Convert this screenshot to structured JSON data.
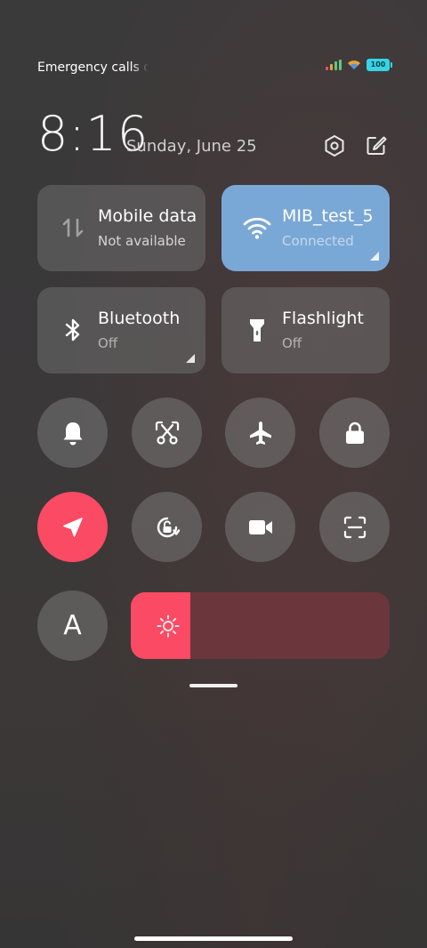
{
  "status_bar": {
    "carrier_text": "Emergency calls o",
    "battery_level": "100",
    "colors": {
      "signal": [
        "#e0556b",
        "#e8a43c",
        "#62c77a",
        "#62c77a"
      ],
      "battery": "#35d4e6"
    }
  },
  "header": {
    "time": "8:16",
    "date": "Sunday, June 25",
    "settings_icon": "settings-hexagon-icon",
    "edit_icon": "edit-pencil-icon"
  },
  "tiles": {
    "mobile_data": {
      "title": "Mobile data",
      "subtitle": "Not available",
      "icon": "mobile-data-arrows-icon"
    },
    "wifi": {
      "title": "MIB_test_5",
      "subtitle": "Connected",
      "icon": "wifi-icon",
      "color": "#7aa8d6"
    },
    "bluetooth": {
      "title": "Bluetooth",
      "subtitle": "Off",
      "icon": "bluetooth-icon"
    },
    "flashlight": {
      "title": "Flashlight",
      "subtitle": "Off",
      "icon": "flashlight-icon"
    }
  },
  "toggles": {
    "row1": [
      {
        "name": "bell-icon",
        "state": "off"
      },
      {
        "name": "screenshot-scissors-icon",
        "state": "off"
      },
      {
        "name": "airplane-icon",
        "state": "off"
      },
      {
        "name": "lock-icon",
        "state": "off"
      }
    ],
    "row2": [
      {
        "name": "location-arrow-icon",
        "state": "on"
      },
      {
        "name": "rotation-lock-icon",
        "state": "off"
      },
      {
        "name": "video-camera-icon",
        "state": "off"
      },
      {
        "name": "scan-frame-icon",
        "state": "off"
      }
    ],
    "font_toggle_letter": "A",
    "active_color": "#fb4a63"
  },
  "brightness": {
    "level_percent": 23,
    "icon": "sun-icon",
    "colors": {
      "fill": "#fb4a63",
      "track": "#6b363c"
    }
  }
}
